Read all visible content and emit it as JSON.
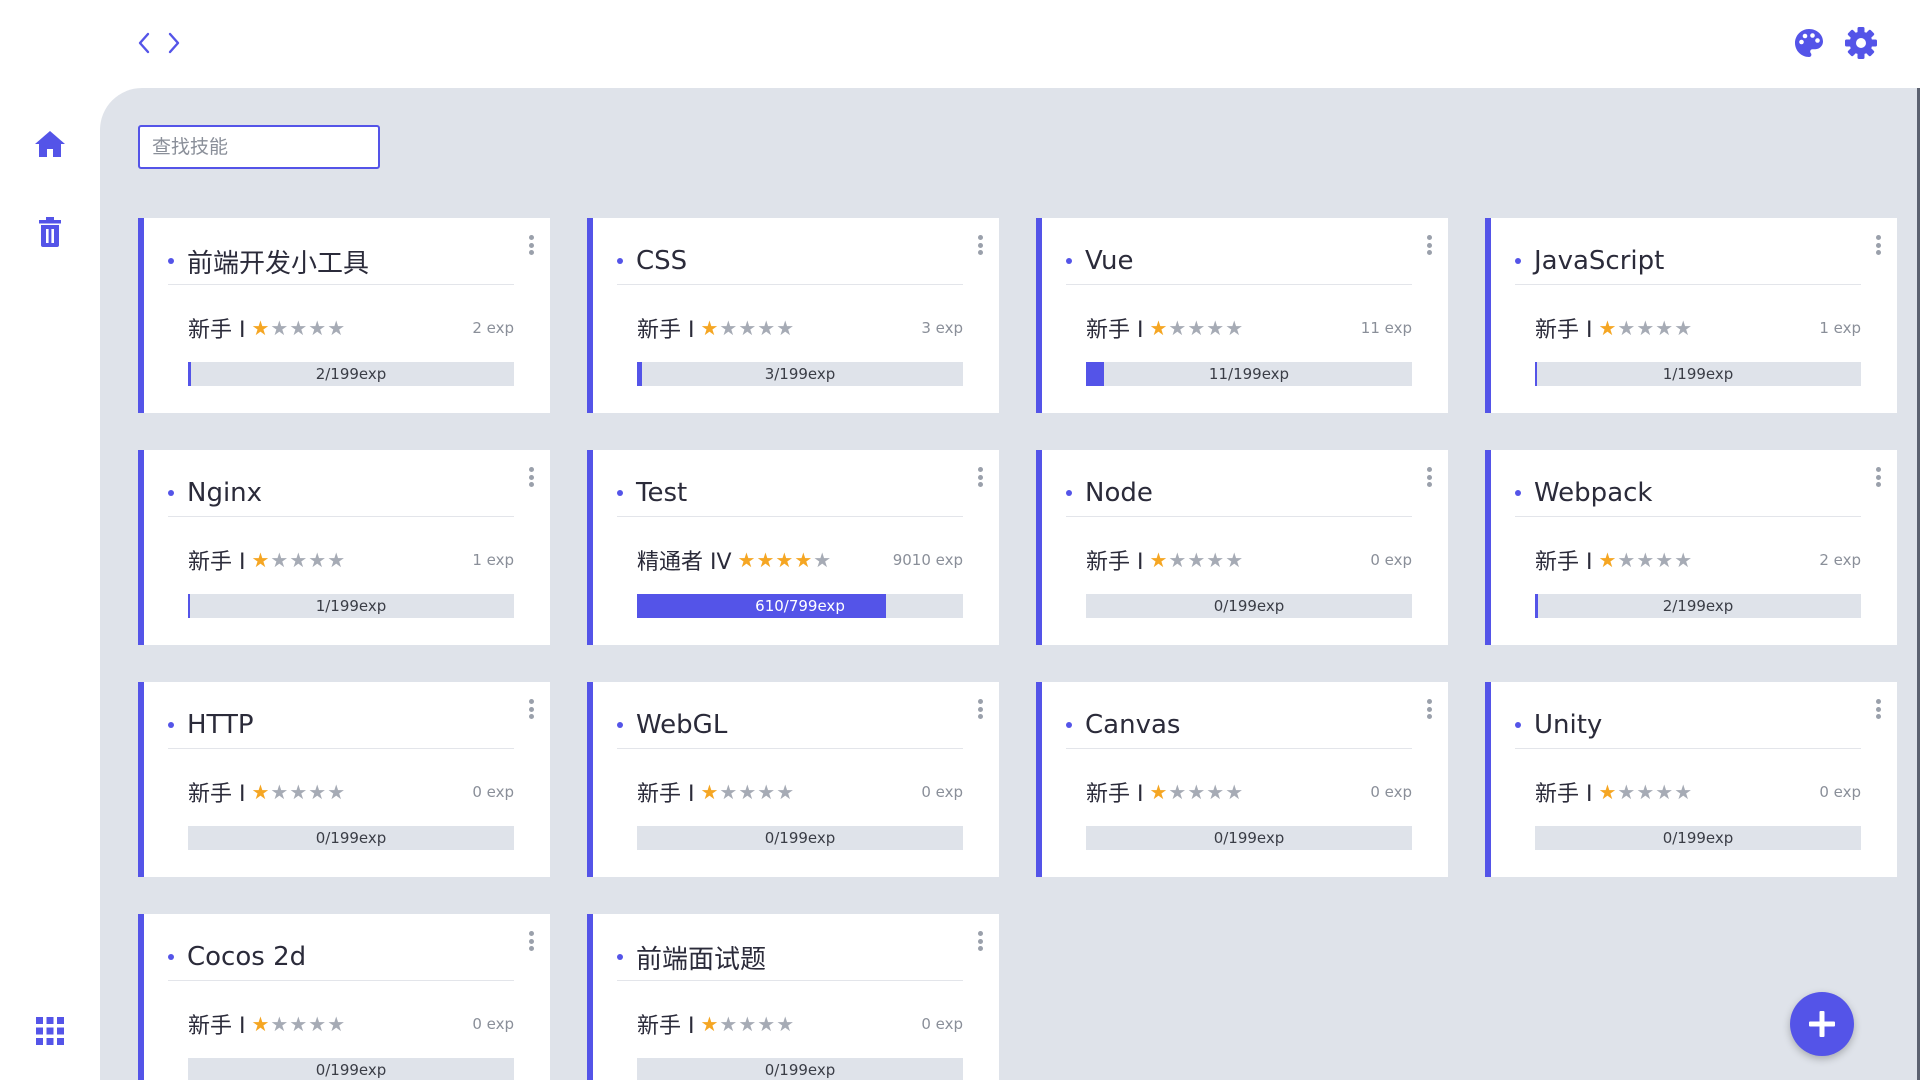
{
  "nav": {
    "back_icon": "chevron-left-icon",
    "forward_icon": "chevron-right-icon"
  },
  "toolbar": {
    "theme_icon": "palette-icon",
    "settings_icon": "gear-icon"
  },
  "sidebar": {
    "items": [
      {
        "name": "home",
        "icon": "home-icon"
      },
      {
        "name": "trash",
        "icon": "trash-icon"
      },
      {
        "name": "apps",
        "icon": "grid-icon"
      }
    ]
  },
  "search": {
    "placeholder": "查找技能",
    "value": ""
  },
  "colors": {
    "accent": "#5454e8",
    "star": "#f5a623",
    "panel": "#dfe3ea"
  },
  "skills": [
    {
      "title": "前端开发小工具",
      "level": "新手 I",
      "stars": 1,
      "exp": "2 exp",
      "progress_label": "2/199exp",
      "progress": 0.01
    },
    {
      "title": "CSS",
      "level": "新手 I",
      "stars": 1,
      "exp": "3 exp",
      "progress_label": "3/199exp",
      "progress": 0.015
    },
    {
      "title": "Vue",
      "level": "新手 I",
      "stars": 1,
      "exp": "11 exp",
      "progress_label": "11/199exp",
      "progress": 0.055
    },
    {
      "title": "JavaScript",
      "level": "新手 I",
      "stars": 1,
      "exp": "1 exp",
      "progress_label": "1/199exp",
      "progress": 0.005
    },
    {
      "title": "Nginx",
      "level": "新手 I",
      "stars": 1,
      "exp": "1 exp",
      "progress_label": "1/199exp",
      "progress": 0.005
    },
    {
      "title": "Test",
      "level": "精通者 IV",
      "stars": 4,
      "exp": "9010 exp",
      "progress_label": "610/799exp",
      "progress": 0.763
    },
    {
      "title": "Node",
      "level": "新手 I",
      "stars": 1,
      "exp": "0 exp",
      "progress_label": "0/199exp",
      "progress": 0
    },
    {
      "title": "Webpack",
      "level": "新手 I",
      "stars": 1,
      "exp": "2 exp",
      "progress_label": "2/199exp",
      "progress": 0.01
    },
    {
      "title": "HTTP",
      "level": "新手 I",
      "stars": 1,
      "exp": "0 exp",
      "progress_label": "0/199exp",
      "progress": 0
    },
    {
      "title": "WebGL",
      "level": "新手 I",
      "stars": 1,
      "exp": "0 exp",
      "progress_label": "0/199exp",
      "progress": 0
    },
    {
      "title": "Canvas",
      "level": "新手 I",
      "stars": 1,
      "exp": "0 exp",
      "progress_label": "0/199exp",
      "progress": 0
    },
    {
      "title": "Unity",
      "level": "新手 I",
      "stars": 1,
      "exp": "0 exp",
      "progress_label": "0/199exp",
      "progress": 0
    },
    {
      "title": "Cocos 2d",
      "level": "新手 I",
      "stars": 1,
      "exp": "0 exp",
      "progress_label": "0/199exp",
      "progress": 0
    },
    {
      "title": "前端面试题",
      "level": "新手 I",
      "stars": 1,
      "exp": "0 exp",
      "progress_label": "0/199exp",
      "progress": 0
    }
  ],
  "fab": {
    "icon": "plus-icon"
  }
}
